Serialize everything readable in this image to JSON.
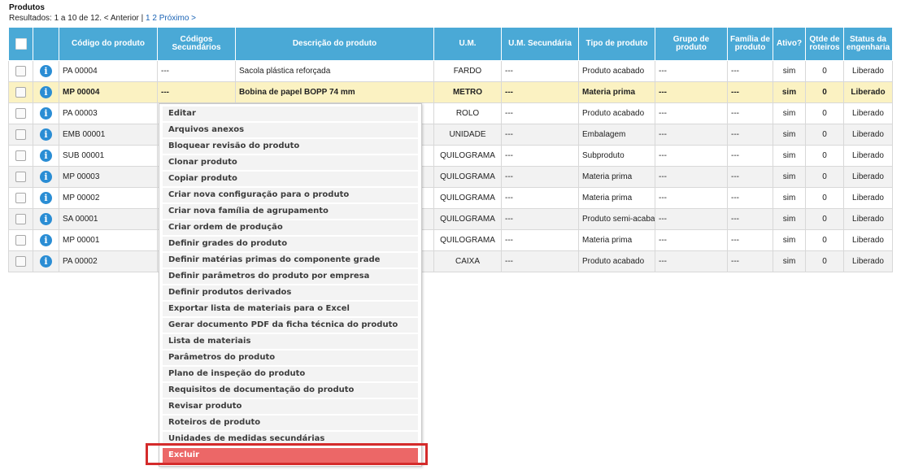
{
  "page": {
    "title": "Produtos"
  },
  "pagination": {
    "results_text": "Resultados: 1 a 10 de 12.",
    "prev_label": "< Anterior",
    "separator": "|",
    "page1": "1",
    "page2": "2",
    "next_label": "Próximo >"
  },
  "table": {
    "headers": [
      "Código do produto",
      "Códigos Secundários",
      "Descrição do produto",
      "U.M.",
      "U.M. Secundária",
      "Tipo de produto",
      "Grupo de produto",
      "Família de produto",
      "Ativo?",
      "Qtde de roteiros",
      "Status da engenharia"
    ],
    "rows": [
      [
        "PA 00004",
        "---",
        "Sacola plástica reforçada",
        "FARDO",
        "---",
        "Produto acabado",
        "---",
        "---",
        "sim",
        "0",
        "Liberado"
      ],
      [
        "MP 00004",
        "---",
        "Bobina de papel BOPP 74 mm",
        "METRO",
        "---",
        "Materia prima",
        "---",
        "---",
        "sim",
        "0",
        "Liberado"
      ],
      [
        "PA 00003",
        "",
        "",
        "ROLO",
        "---",
        "Produto acabado",
        "---",
        "---",
        "sim",
        "0",
        "Liberado"
      ],
      [
        "EMB 00001",
        "",
        "",
        "UNIDADE",
        "---",
        "Embalagem",
        "---",
        "---",
        "sim",
        "0",
        "Liberado"
      ],
      [
        "SUB 00001",
        "",
        "",
        "QUILOGRAMA",
        "---",
        "Subproduto",
        "---",
        "---",
        "sim",
        "0",
        "Liberado"
      ],
      [
        "MP 00003",
        "",
        "",
        "QUILOGRAMA",
        "---",
        "Materia prima",
        "---",
        "---",
        "sim",
        "0",
        "Liberado"
      ],
      [
        "MP 00002",
        "",
        "",
        "QUILOGRAMA",
        "---",
        "Materia prima",
        "---",
        "---",
        "sim",
        "0",
        "Liberado"
      ],
      [
        "SA 00001",
        "",
        "",
        "QUILOGRAMA",
        "---",
        "Produto semi-acabado",
        "---",
        "---",
        "sim",
        "0",
        "Liberado"
      ],
      [
        "MP 00001",
        "",
        "",
        "QUILOGRAMA",
        "---",
        "Materia prima",
        "---",
        "---",
        "sim",
        "0",
        "Liberado"
      ],
      [
        "PA 00002",
        "",
        "",
        "CAIXA",
        "---",
        "Produto acabado",
        "---",
        "---",
        "sim",
        "0",
        "Liberado"
      ]
    ],
    "selected_row": 1,
    "info_glyph": "i"
  },
  "context_menu": {
    "items": [
      "Editar",
      "Arquivos anexos",
      "Bloquear revisão do produto",
      "Clonar produto",
      "Copiar produto",
      "Criar nova configuração para o produto",
      "Criar nova família de agrupamento",
      "Criar ordem de produção",
      "Definir grades do produto",
      "Definir matérias primas do componente grade",
      "Definir parâmetros do produto por empresa",
      "Definir produtos derivados",
      "Exportar lista de materiais para o Excel",
      "Gerar documento PDF da ficha técnica do produto",
      "Lista de materiais",
      "Parâmetros do produto",
      "Plano de inspeção do produto",
      "Requisitos de documentação do produto",
      "Revisar produto",
      "Roteiros de produto",
      "Unidades de medidas secundárias",
      "Excluir"
    ],
    "danger_item": "Excluir"
  },
  "colors": {
    "header_bg": "#4aa9d6",
    "selected_row_bg": "#fbf2c2",
    "info_icon": "#2a8dd4",
    "danger_bg": "#ec6767",
    "highlight_border": "#d42b2b"
  },
  "icons": {
    "row_info": "info-icon",
    "row_checkbox": "checkbox",
    "select_all": "select-all-checkbox"
  }
}
